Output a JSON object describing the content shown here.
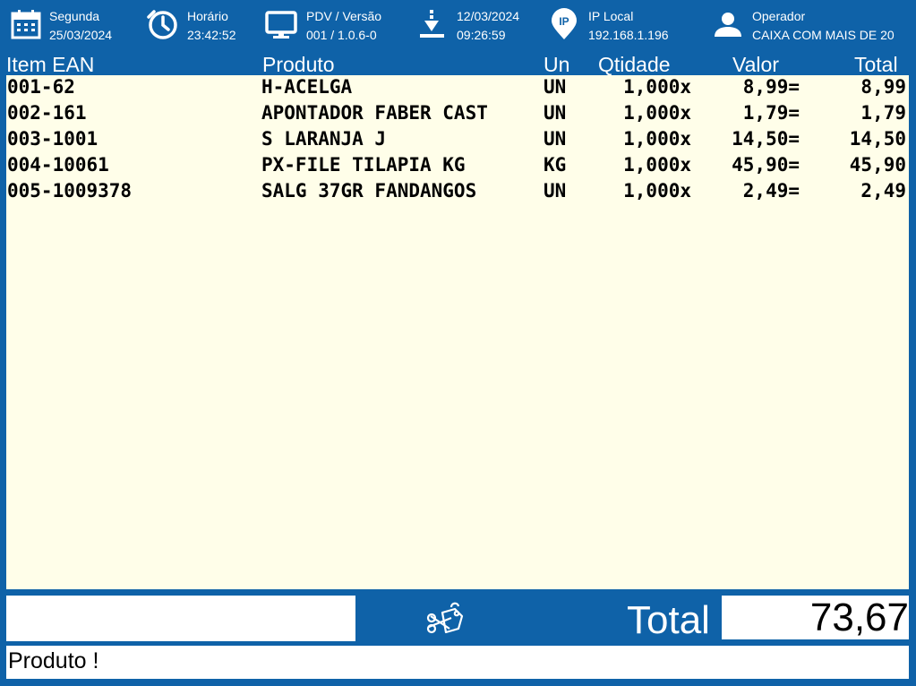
{
  "header": {
    "date": {
      "line1": "Segunda",
      "line2": "25/03/2024"
    },
    "time": {
      "line1": "Horário",
      "line2": "23:42:52"
    },
    "pdv": {
      "line1": "PDV / Versão",
      "line2": "001 / 1.0.6-0"
    },
    "download": {
      "line1": "12/03/2024",
      "line2": "09:26:59"
    },
    "ip": {
      "line1": "IP Local",
      "line2": "192.168.1.196"
    },
    "operator": {
      "line1": "Operador",
      "line2": "CAIXA COM MAIS DE 20"
    }
  },
  "columns": {
    "item_ean": "Item  EAN",
    "produto": "Produto",
    "un": "Un",
    "qtidade": "Qtidade",
    "valor": "Valor",
    "total": "Total"
  },
  "rows": [
    {
      "item": "001-62",
      "produto": "H-ACELGA",
      "un": "UN",
      "qtd": "1,000x",
      "valor": "8,99=",
      "total": "8,99"
    },
    {
      "item": "002-161",
      "produto": "APONTADOR FABER CAST",
      "un": "UN",
      "qtd": "1,000x",
      "valor": "1,79=",
      "total": "1,79"
    },
    {
      "item": "003-1001",
      "produto": "S LARANJA J",
      "un": "UN",
      "qtd": "1,000x",
      "valor": "14,50=",
      "total": "14,50"
    },
    {
      "item": "004-10061",
      "produto": "PX-FILE TILAPIA KG",
      "un": "KG",
      "qtd": "1,000x",
      "valor": "45,90=",
      "total": "45,90"
    },
    {
      "item": "005-1009378",
      "produto": "SALG 37GR FANDANGOS",
      "un": "UN",
      "qtd": "1,000x",
      "valor": "2,49=",
      "total": "2,49"
    }
  ],
  "footer": {
    "input_value": "",
    "total_label": "Total",
    "total_value": "73,67",
    "status_message": "Produto !"
  },
  "colors": {
    "background": "#0f62a8",
    "grid": "#fffee9"
  },
  "icons": [
    "calendar-icon",
    "clock-icon",
    "monitor-icon",
    "download-icon",
    "ip-pin-icon",
    "user-icon",
    "price-tag-icon"
  ]
}
